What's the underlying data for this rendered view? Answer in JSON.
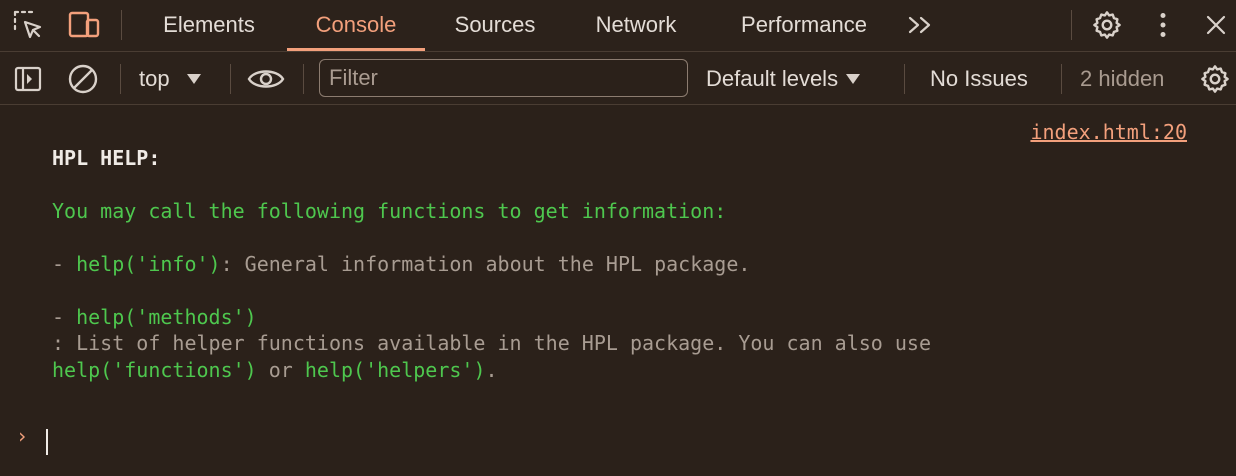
{
  "tabs": {
    "items": [
      "Elements",
      "Console",
      "Sources",
      "Network",
      "Performance"
    ],
    "active": "Console",
    "more": "»"
  },
  "toolbar": {
    "context": "top",
    "filter_placeholder": "Filter",
    "levels": "Default levels",
    "issues": "No Issues",
    "hidden": "2 hidden"
  },
  "console": {
    "source_link": "index.html:20",
    "heading": "HPL HELP:",
    "intro": "You may call the following functions to get information:",
    "item1": {
      "dash": "- ",
      "code": "help('info')",
      "text": ": General information about the HPL package."
    },
    "item2": {
      "dash": "- ",
      "code": "help('methods')",
      "text": ": List of helper functions available in the HPL package. You can also use",
      "code2": "help('functions')",
      "or": " or ",
      "code3": "help('helpers')",
      "end": "."
    },
    "prompt": "›"
  },
  "colors": {
    "background": "#2b211a",
    "accent": "#f3a07c",
    "green": "#4ec74e",
    "grey_text": "#a89c92"
  }
}
